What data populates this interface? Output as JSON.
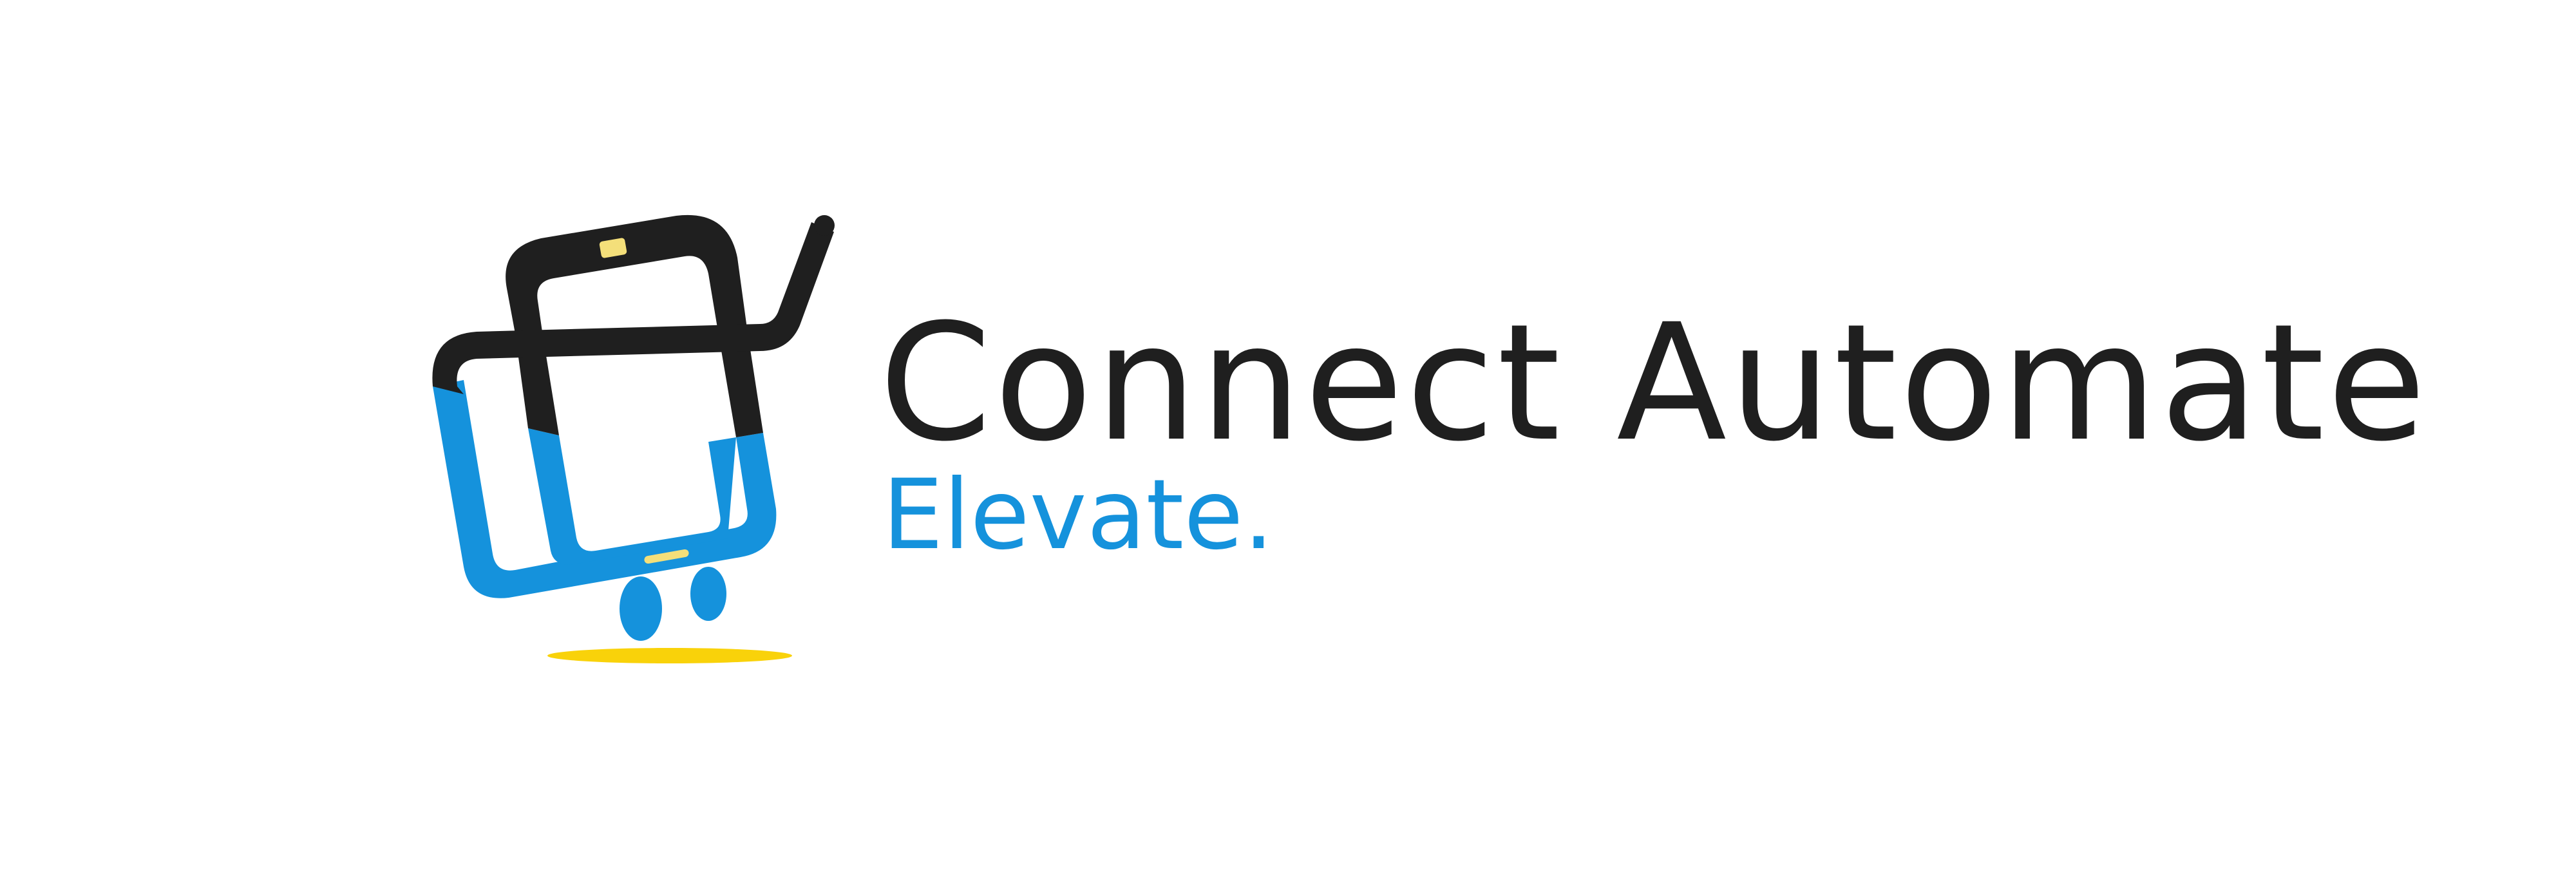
{
  "brand": {
    "name": "Connect Automate",
    "tagline": "Elevate.",
    "logo_icon": "shopping-cart-with-tilted-devices-icon"
  },
  "colors": {
    "dark": "#1f1f1f",
    "blue": "#1592dc",
    "yellow": "#f9d20a",
    "chip": "#f4df7a",
    "background": "#ffffff"
  }
}
